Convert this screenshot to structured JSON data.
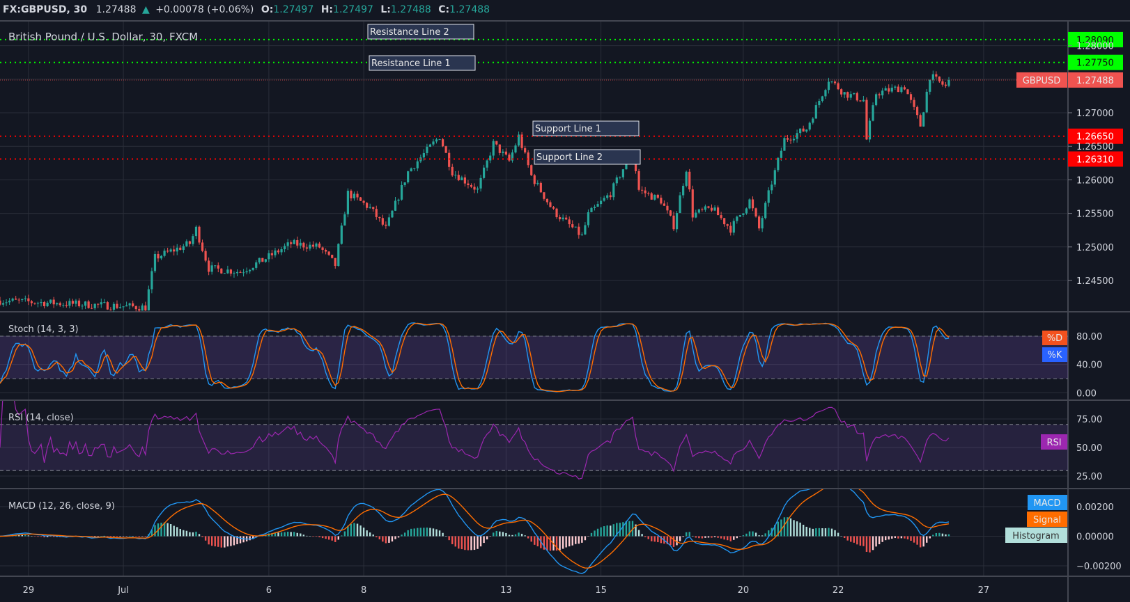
{
  "header": {
    "symbol": "FX:GBPUSD, 30",
    "last": "1.27488",
    "change": "+0.00078 (+0.06%)",
    "open_label": "O:",
    "open": "1.27497",
    "high_label": "H:",
    "high": "1.27497",
    "low_label": "L:",
    "low": "1.27488",
    "close_label": "C:",
    "close": "1.27488"
  },
  "title": "British Pound / U.S. Dollar, 30, FXCM",
  "colors": {
    "background": "#131722",
    "grid": "#2a2e39",
    "up": "#26a69a",
    "down": "#ef5350",
    "resistance": "#00ff00",
    "support": "#ff0000",
    "stoch_k": "#2196f3",
    "stoch_d": "#ff6d00",
    "rsi": "#9c27b0",
    "macd": "#2196f3",
    "signal": "#ff6d00"
  },
  "drawings": [
    {
      "label": "Resistance Line 2",
      "price": 1.2809,
      "price_label": "1.28090",
      "kind": "resistance"
    },
    {
      "label": "Resistance Line 1",
      "price": 1.2775,
      "price_label": "1.27750",
      "kind": "resistance"
    },
    {
      "label": "Support Line 1",
      "price": 1.2665,
      "price_label": "1.26650",
      "kind": "support"
    },
    {
      "label": "Support Line 2",
      "price": 1.2631,
      "price_label": "1.26310",
      "kind": "support"
    }
  ],
  "current_price": {
    "symbol": "GBPUSD",
    "price": 1.27488,
    "price_label": "1.27488"
  },
  "price_axis": [
    "1.28000",
    "1.27000",
    "1.26500",
    "1.26000",
    "1.25500",
    "1.25000",
    "1.24500"
  ],
  "time_axis": [
    {
      "label": "29",
      "bar": 9
    },
    {
      "label": "Jul",
      "bar": 39
    },
    {
      "label": "6",
      "bar": 85
    },
    {
      "label": "8",
      "bar": 115
    },
    {
      "label": "13",
      "bar": 160
    },
    {
      "label": "15",
      "bar": 190
    },
    {
      "label": "20",
      "bar": 235
    },
    {
      "label": "22",
      "bar": 265
    },
    {
      "label": "27",
      "bar": 311
    }
  ],
  "indicators": {
    "stoch": {
      "title": "Stoch (14, 3, 3)",
      "axis": [
        "80.00",
        "40.00",
        "0.00"
      ],
      "d_label": "%D",
      "k_label": "%K",
      "bands": [
        20,
        80
      ]
    },
    "rsi": {
      "title": "RSI (14, close)",
      "axis": [
        "75.00",
        "50.00",
        "25.00"
      ],
      "label": "RSI",
      "bands": [
        30,
        70
      ]
    },
    "macd": {
      "title": "MACD (12, 26, close, 9)",
      "axis": [
        "0.00200",
        "0.00000",
        "−0.00200"
      ],
      "macd_label": "MACD",
      "signal_label": "Signal",
      "hist_label": "Histogram"
    }
  },
  "chart_data": {
    "type": "candlestick",
    "interval": "30",
    "price_range": [
      1.2415,
      1.2825
    ],
    "close_path": [
      [
        0,
        1.242
      ],
      [
        46,
        1.241
      ],
      [
        49,
        1.2484
      ],
      [
        60,
        1.2505
      ],
      [
        62,
        1.2527
      ],
      [
        66,
        1.2468
      ],
      [
        76,
        1.2463
      ],
      [
        83,
        1.248
      ],
      [
        92,
        1.2505
      ],
      [
        101,
        1.25
      ],
      [
        106,
        1.2473
      ],
      [
        110,
        1.258
      ],
      [
        117,
        1.2558
      ],
      [
        122,
        1.2527
      ],
      [
        129,
        1.2612
      ],
      [
        139,
        1.2665
      ],
      [
        143,
        1.2612
      ],
      [
        151,
        1.2585
      ],
      [
        156,
        1.2654
      ],
      [
        161,
        1.2628
      ],
      [
        164,
        1.2665
      ],
      [
        168,
        1.2606
      ],
      [
        175,
        1.2553
      ],
      [
        184,
        1.2516
      ],
      [
        186,
        1.2548
      ],
      [
        193,
        1.258
      ],
      [
        200,
        1.2644
      ],
      [
        202,
        1.2585
      ],
      [
        209,
        1.2569
      ],
      [
        213,
        1.2532
      ],
      [
        217,
        1.2617
      ],
      [
        219,
        1.2548
      ],
      [
        225,
        1.2558
      ],
      [
        231,
        1.2527
      ],
      [
        237,
        1.2569
      ],
      [
        240,
        1.2527
      ],
      [
        244,
        1.2596
      ],
      [
        248,
        1.266
      ],
      [
        255,
        1.2676
      ],
      [
        262,
        1.275
      ],
      [
        267,
        1.2729
      ],
      [
        273,
        1.2719
      ],
      [
        274,
        1.266
      ],
      [
        277,
        1.2729
      ],
      [
        286,
        1.2739
      ],
      [
        291,
        1.2681
      ],
      [
        294,
        1.2755
      ],
      [
        299,
        1.2739
      ],
      [
        300,
        1.27488
      ]
    ]
  }
}
